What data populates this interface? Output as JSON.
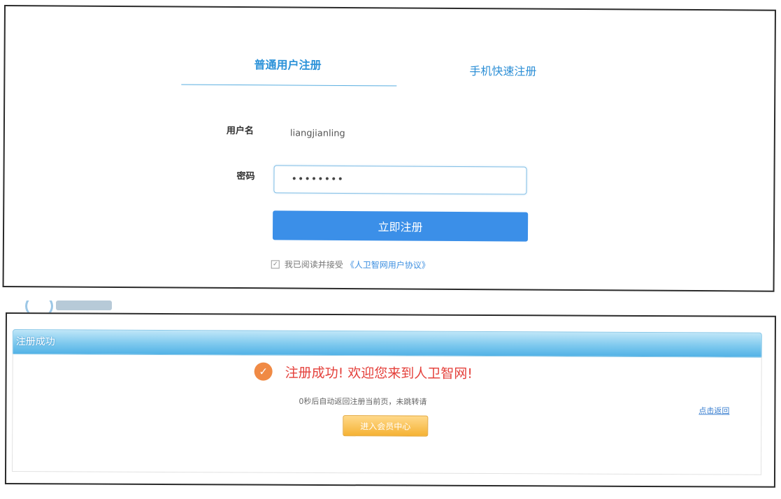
{
  "register": {
    "tabs": [
      "普通用户注册",
      "手机快速注册"
    ],
    "username_label": "用户名",
    "username_value": "liangjianling",
    "password_label": "密码",
    "password_value": "••••••••",
    "submit_label": "立即注册",
    "agree_text": "我已阅读并接受",
    "agree_link": "《人卫智网用户协议》"
  },
  "success": {
    "header_title": "注册成功",
    "message": "注册成功! 欢迎您来到人卫智网!",
    "redirect_text": "0秒后自动返回注册当前页，未跳转请",
    "return_link": "点击返回",
    "member_center_button": "进入会员中心"
  },
  "colors": {
    "primary_blue": "#3b8fe8",
    "success_red": "#e4403b",
    "orange_button": "#f5b234"
  }
}
